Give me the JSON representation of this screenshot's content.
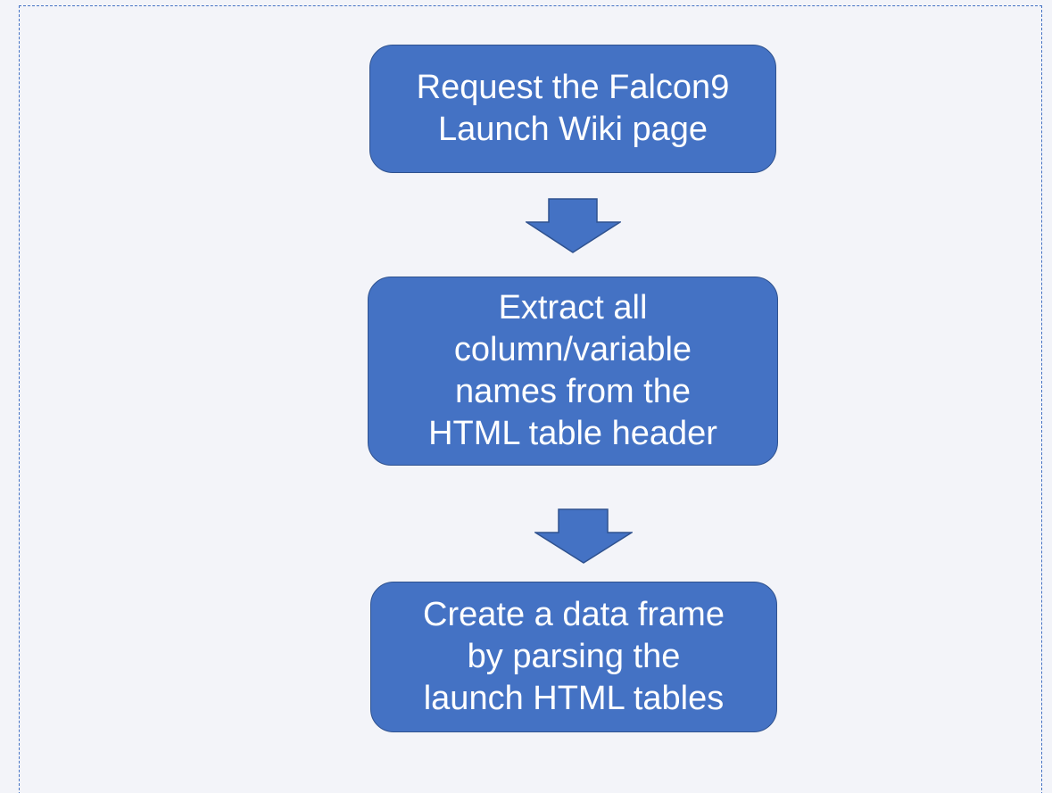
{
  "flowchart": {
    "steps": [
      {
        "lines": [
          "Request the Falcon9",
          "Launch Wiki page"
        ]
      },
      {
        "lines": [
          "Extract all",
          "column/variable",
          "names from the",
          "HTML table header"
        ]
      },
      {
        "lines": [
          "Create a data frame",
          "by parsing the",
          "launch HTML tables"
        ]
      }
    ]
  },
  "colors": {
    "box_fill": "#4472c4",
    "box_border": "#2f528f",
    "text": "#ffffff",
    "background": "#f3f4f9",
    "frame_border": "#4472c4"
  }
}
